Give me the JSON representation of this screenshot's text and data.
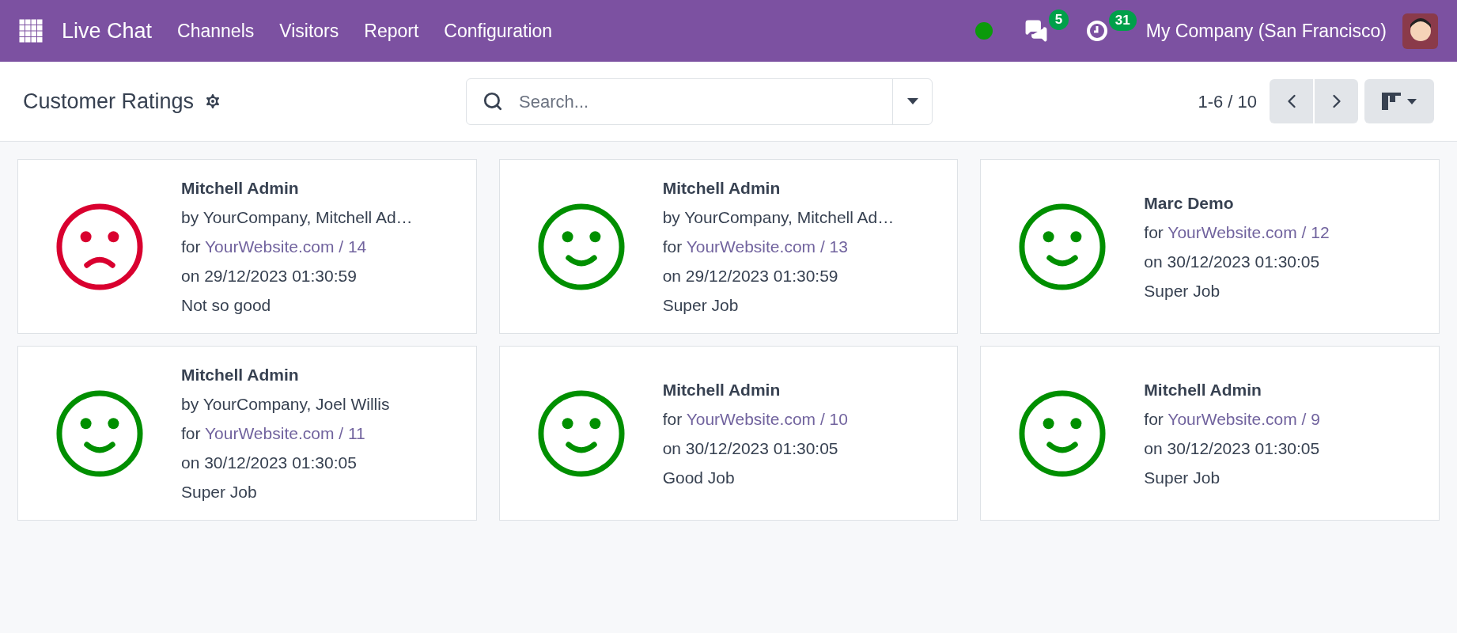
{
  "navbar": {
    "app_name": "Live Chat",
    "menus": [
      "Channels",
      "Visitors",
      "Report",
      "Configuration"
    ],
    "status_online": true,
    "messages_count": "5",
    "activities_count": "31",
    "company": "My Company (San Francisco)"
  },
  "control_panel": {
    "title": "Customer Ratings",
    "search": {
      "placeholder": "Search..."
    },
    "pager": "1-6 / 10"
  },
  "cards": [
    {
      "kind": "sad",
      "name": "Mitchell Admin",
      "by": "by YourCompany, Mitchell Ad…",
      "for_label": "for",
      "link": "YourWebsite.com / 14",
      "date": "on 29/12/2023 01:30:59",
      "feedback": "Not so good"
    },
    {
      "kind": "happy",
      "name": "Mitchell Admin",
      "by": "by YourCompany, Mitchell Ad…",
      "for_label": "for",
      "link": "YourWebsite.com / 13",
      "date": "on 29/12/2023 01:30:59",
      "feedback": "Super Job"
    },
    {
      "kind": "happy",
      "name": "Marc Demo",
      "for_label": "for",
      "link": "YourWebsite.com / 12",
      "date": "on 30/12/2023 01:30:05",
      "feedback": "Super Job"
    },
    {
      "kind": "happy",
      "name": "Mitchell Admin",
      "by": "by YourCompany, Joel Willis",
      "for_label": "for",
      "link": "YourWebsite.com / 11",
      "date": "on 30/12/2023 01:30:05",
      "feedback": "Super Job"
    },
    {
      "kind": "happy",
      "name": "Mitchell Admin",
      "for_label": "for",
      "link": "YourWebsite.com / 10",
      "date": "on 30/12/2023 01:30:05",
      "feedback": "Good Job"
    },
    {
      "kind": "happy",
      "name": "Mitchell Admin",
      "for_label": "for",
      "link": "YourWebsite.com / 9",
      "date": "on 30/12/2023 01:30:05",
      "feedback": "Super Job"
    }
  ]
}
